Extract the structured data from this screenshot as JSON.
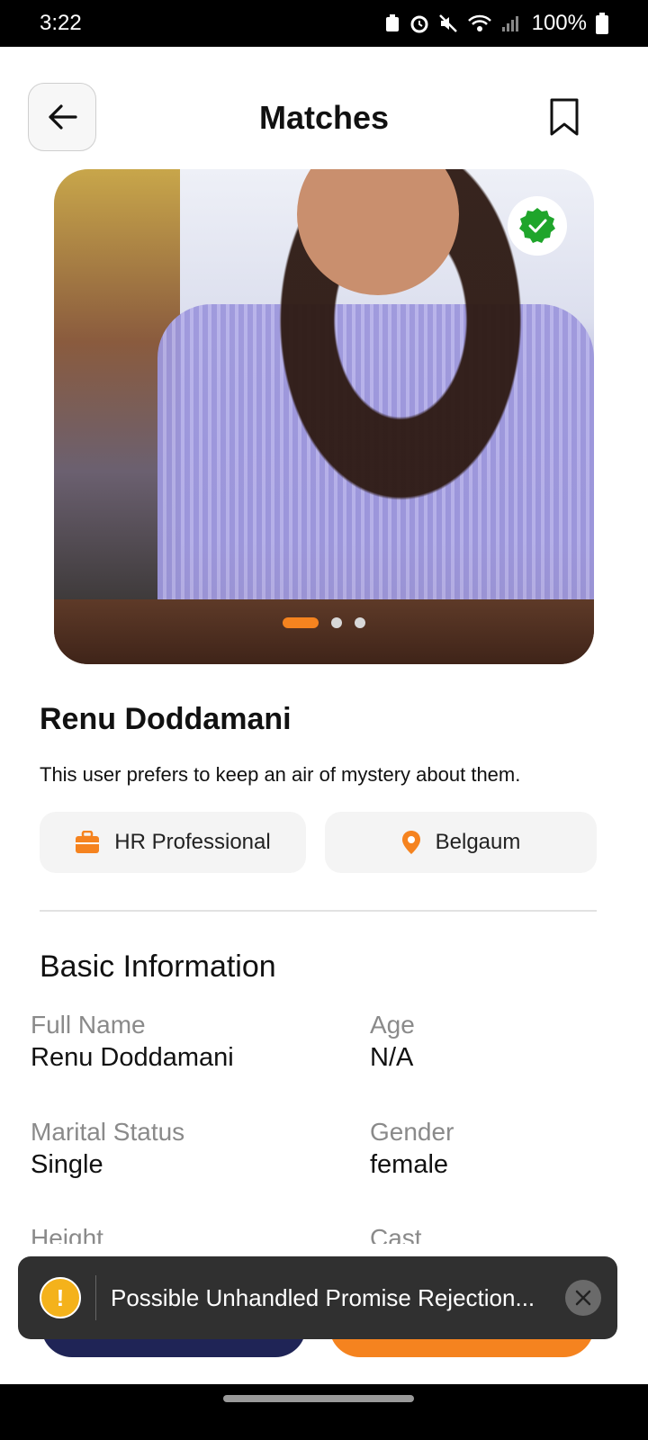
{
  "status_bar": {
    "time": "3:22",
    "battery": "100%",
    "icons": [
      "recycle-icon",
      "alarm-icon",
      "mute-icon",
      "wifi-icon",
      "signal-icon",
      "battery-icon"
    ]
  },
  "header": {
    "title": "Matches",
    "back_icon": "arrow-left-icon",
    "bookmark_icon": "bookmark-icon"
  },
  "photo": {
    "slides_total": 3,
    "active_slide": 1,
    "verified": true
  },
  "profile": {
    "name": "Renu Doddamani",
    "bio": "This user prefers to keep an air of mystery about them.",
    "occupation": "HR Professional",
    "location": "Belgaum"
  },
  "basic_info": {
    "title": "Basic Information",
    "fields": [
      {
        "label": "Full Name",
        "value": "Renu Doddamani"
      },
      {
        "label": "Age",
        "value": "N/A"
      },
      {
        "label": "Marital Status",
        "value": "Single"
      },
      {
        "label": "Gender",
        "value": "female"
      },
      {
        "label": "Height",
        "value": ""
      },
      {
        "label": "Cast",
        "value": ""
      }
    ]
  },
  "toast": {
    "message": "Possible Unhandled Promise Rejection..."
  },
  "colors": {
    "accent": "#f5831f",
    "navy": "#1f2456",
    "verified": "#1fa52b"
  }
}
